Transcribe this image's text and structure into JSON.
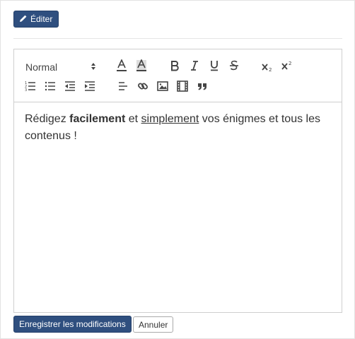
{
  "header": {
    "edit_label": "Éditer"
  },
  "toolbar": {
    "format_select": "Normal",
    "icons": [
      "text-color-icon",
      "background-color-icon",
      "bold-icon",
      "italic-icon",
      "underline-icon",
      "strike-icon",
      "subscript-icon",
      "superscript-icon",
      "ordered-list-icon",
      "bullet-list-icon",
      "outdent-icon",
      "indent-icon",
      "align-icon",
      "link-icon",
      "image-icon",
      "video-icon",
      "blockquote-icon"
    ]
  },
  "content": {
    "part1": "Rédigez ",
    "bold": "facilement",
    "part2": " et ",
    "underlined": "simplement",
    "part3": " vos énigmes et tous les contenus !"
  },
  "footer": {
    "save_label": "Enregistrer les modifications",
    "cancel_label": "Annuler"
  },
  "colors": {
    "primary": "#2f4f7f",
    "border": "#cfcfcf"
  }
}
